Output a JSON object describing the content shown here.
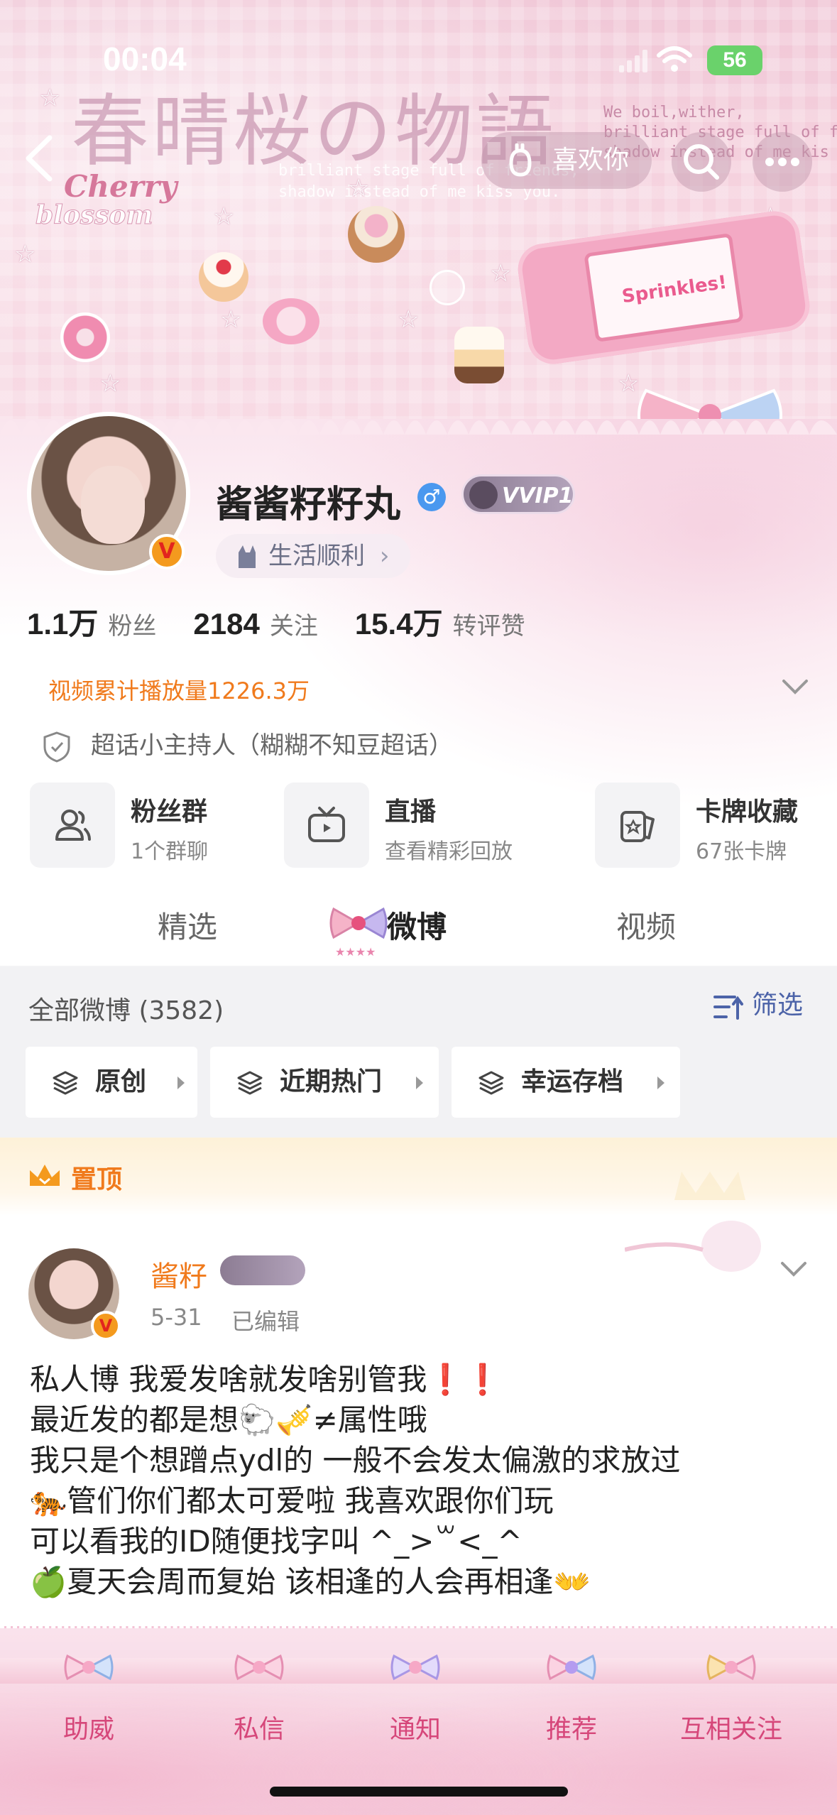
{
  "status_bar": {
    "time": "00:04",
    "battery": "56"
  },
  "header": {
    "title_art": "春晴桜の物語",
    "cherry": "Cherry",
    "blossom": "blossom",
    "eng_text_right": "We boil,wither,\nbrilliant stage full of fri\nshadow instead of me kis",
    "eng_text_center": "brilliant stage full of friends,\nshadow instead of me kiss you.",
    "console_text": "Sprinkles!",
    "like_button": "喜欢你"
  },
  "profile": {
    "username": "酱酱籽籽丸",
    "gender_symbol": "♂",
    "vip_label": "VVIP1",
    "verified_badge": "V",
    "life_chip": "生活顺利",
    "stats": [
      {
        "num": "1.1万",
        "label": "粉丝"
      },
      {
        "num": "2184",
        "label": "关注"
      },
      {
        "num": "15.4万",
        "label": "转评赞"
      }
    ],
    "video_plays": "视频累计播放量1226.3万",
    "host_line": "超话小主持人（糊糊不知豆超话）",
    "services": [
      {
        "title": "粉丝群",
        "subtitle": "1个群聊",
        "icon": "group-icon"
      },
      {
        "title": "直播",
        "subtitle": "查看精彩回放",
        "icon": "tv-icon"
      },
      {
        "title": "卡牌收藏",
        "subtitle": "67张卡牌",
        "icon": "card-icon"
      }
    ],
    "tabs": [
      "精选",
      "微博",
      "视频"
    ],
    "active_tab": "微博"
  },
  "filters": {
    "all_weibo": "全部微博 (3582)",
    "filter_label": "筛选",
    "chips": [
      "原创",
      "近期热门",
      "幸运存档"
    ]
  },
  "post": {
    "pinned_label": "置顶",
    "name": "酱籽",
    "date": "5-31",
    "edited": "已编辑",
    "body": "私人博 我爱发啥就发啥别管我❗️❗️\n最近发的都是想🐑🎺≠属性哦\n我只是个想蹭点ydl的 一般不会发太偏激的求放过\n🐅管们你们都太可爱啦 我喜欢跟你们玩\n可以看我的ID随便找字叫 ^_>꒳<_^\n🍏夏天会周而复始 该相逢的人会再相逢👐"
  },
  "bottom_nav": [
    "助威",
    "私信",
    "通知",
    "推荐",
    "互相关注"
  ],
  "colors": {
    "accent_orange": "#f07a1c",
    "pink_label": "#d6477a",
    "filter_blue": "#4c63a8"
  }
}
